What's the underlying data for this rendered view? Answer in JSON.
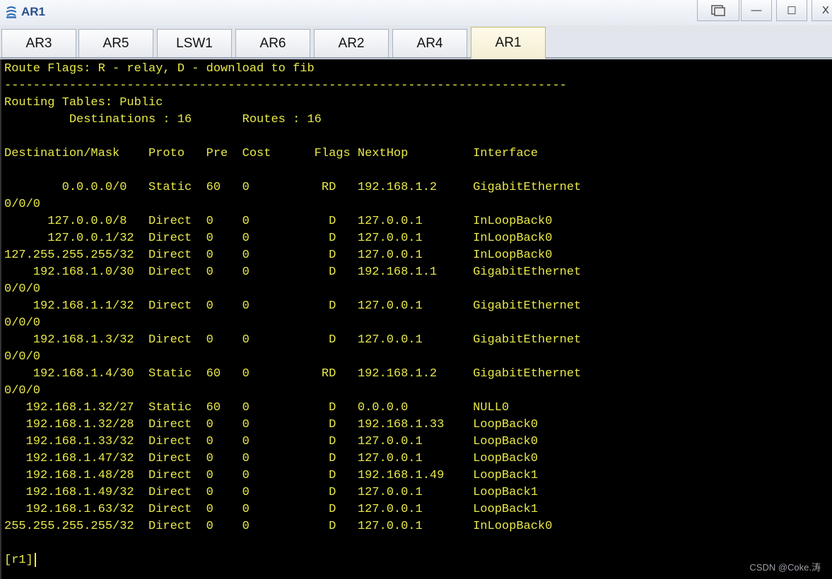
{
  "window": {
    "title": "AR1",
    "controls": {
      "restore_label": "▭",
      "minimize_label": "—",
      "maximize_label": "☐",
      "close_label": "X"
    }
  },
  "tabs": [
    {
      "label": "AR3",
      "active": false
    },
    {
      "label": "AR5",
      "active": false
    },
    {
      "label": "LSW1",
      "active": false
    },
    {
      "label": "AR6",
      "active": false
    },
    {
      "label": "AR2",
      "active": false
    },
    {
      "label": "AR4",
      "active": false
    },
    {
      "label": "AR1",
      "active": true
    }
  ],
  "terminal": {
    "text_color": "#e8e84a",
    "background": "#000000",
    "lines": [
      "Route Flags: R - relay, D - download to fib",
      "------------------------------------------------------------------------------",
      "Routing Tables: Public",
      "         Destinations : 16       Routes : 16",
      "",
      "Destination/Mask    Proto   Pre  Cost      Flags NextHop         Interface",
      "",
      "        0.0.0.0/0   Static  60   0          RD   192.168.1.2     GigabitEthernet",
      "0/0/0",
      "      127.0.0.0/8   Direct  0    0           D   127.0.0.1       InLoopBack0",
      "      127.0.0.1/32  Direct  0    0           D   127.0.0.1       InLoopBack0",
      "127.255.255.255/32  Direct  0    0           D   127.0.0.1       InLoopBack0",
      "    192.168.1.0/30  Direct  0    0           D   192.168.1.1     GigabitEthernet",
      "0/0/0",
      "    192.168.1.1/32  Direct  0    0           D   127.0.0.1       GigabitEthernet",
      "0/0/0",
      "    192.168.1.3/32  Direct  0    0           D   127.0.0.1       GigabitEthernet",
      "0/0/0",
      "    192.168.1.4/30  Static  60   0          RD   192.168.1.2     GigabitEthernet",
      "0/0/0",
      "   192.168.1.32/27  Static  60   0           D   0.0.0.0         NULL0",
      "   192.168.1.32/28  Direct  0    0           D   192.168.1.33    LoopBack0",
      "   192.168.1.33/32  Direct  0    0           D   127.0.0.1       LoopBack0",
      "   192.168.1.47/32  Direct  0    0           D   127.0.0.1       LoopBack0",
      "   192.168.1.48/28  Direct  0    0           D   192.168.1.49    LoopBack1",
      "   192.168.1.49/32  Direct  0    0           D   127.0.0.1       LoopBack1",
      "   192.168.1.63/32  Direct  0    0           D   127.0.0.1       LoopBack1",
      "255.255.255.255/32  Direct  0    0           D   127.0.0.1       InLoopBack0",
      "",
      "[r1]"
    ]
  },
  "watermark": "CSDN @Coke.涛"
}
